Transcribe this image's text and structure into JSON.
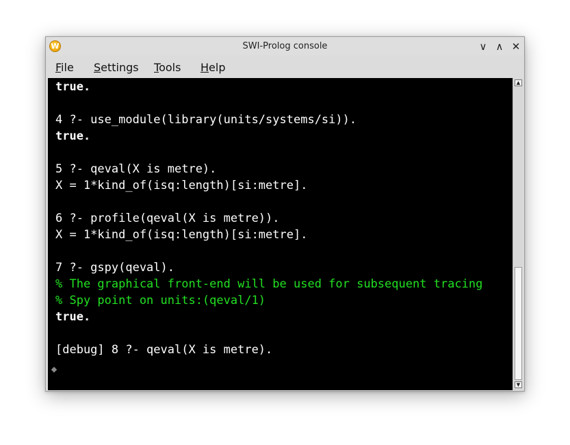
{
  "window": {
    "title": "SWI-Prolog console",
    "icon": "swi-prolog-app-icon",
    "icon_letter": "W",
    "controls": {
      "minimize": "∨",
      "maximize": "∧",
      "close": "✕"
    }
  },
  "menu": {
    "items": [
      {
        "label": "File",
        "mnemonic": "F",
        "rest": "ile"
      },
      {
        "label": "Settings",
        "mnemonic": "S",
        "rest": "ettings"
      },
      {
        "label": "Tools",
        "mnemonic": "T",
        "rest": "ools"
      },
      {
        "label": "Help",
        "mnemonic": "H",
        "rest": "elp"
      }
    ]
  },
  "console": {
    "lines": [
      "true.",
      "4 ?- use_module(library(units/systems/si)).",
      "true.",
      "5 ?- qeval(X is metre).",
      "X = 1*kind_of(isq:length)[si:metre].",
      "6 ?- profile(qeval(X is metre)).",
      "X = 1*kind_of(isq:length)[si:metre].",
      "7 ?- gspy(qeval).",
      "% The graphical front-end will be used for subsequent tracing",
      "% Spy point on units:(qeval/1)",
      "true.",
      "[debug] 8 ?- qeval(X is metre)."
    ],
    "colors": {
      "background": "#000000",
      "text": "#ffffff",
      "message": "#22e022"
    }
  },
  "scrollbar": {
    "up_arrow": "▲",
    "down_arrow": "▼"
  }
}
